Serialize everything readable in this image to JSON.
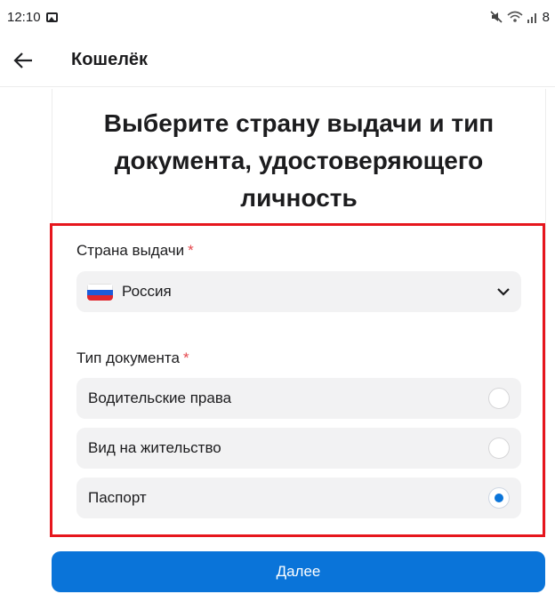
{
  "status_bar": {
    "time": "12:10",
    "icons": [
      "gallery-icon",
      "mute-icon",
      "wifi-icon",
      "signal-icon"
    ],
    "battery_partial": "8"
  },
  "header": {
    "title": "Кошелёк",
    "back_icon": "arrow-left-icon"
  },
  "main": {
    "heading": "Выберите страну выдачи и тип документа, удостоверяющего личность",
    "country": {
      "label": "Страна выдачи",
      "required_mark": "*",
      "selected": "Россия",
      "flag_icon": "russia-flag-icon"
    },
    "document_type": {
      "label": "Тип документа",
      "required_mark": "*",
      "options": [
        {
          "label": "Водительские права",
          "checked": false
        },
        {
          "label": "Вид на жительство",
          "checked": false
        },
        {
          "label": "Паспорт",
          "checked": true
        }
      ]
    },
    "next_label": "Далее"
  },
  "colors": {
    "accent": "#0a74d9",
    "required": "#e5484d",
    "highlight_border": "#e6161d",
    "field_bg": "#f2f2f3"
  }
}
